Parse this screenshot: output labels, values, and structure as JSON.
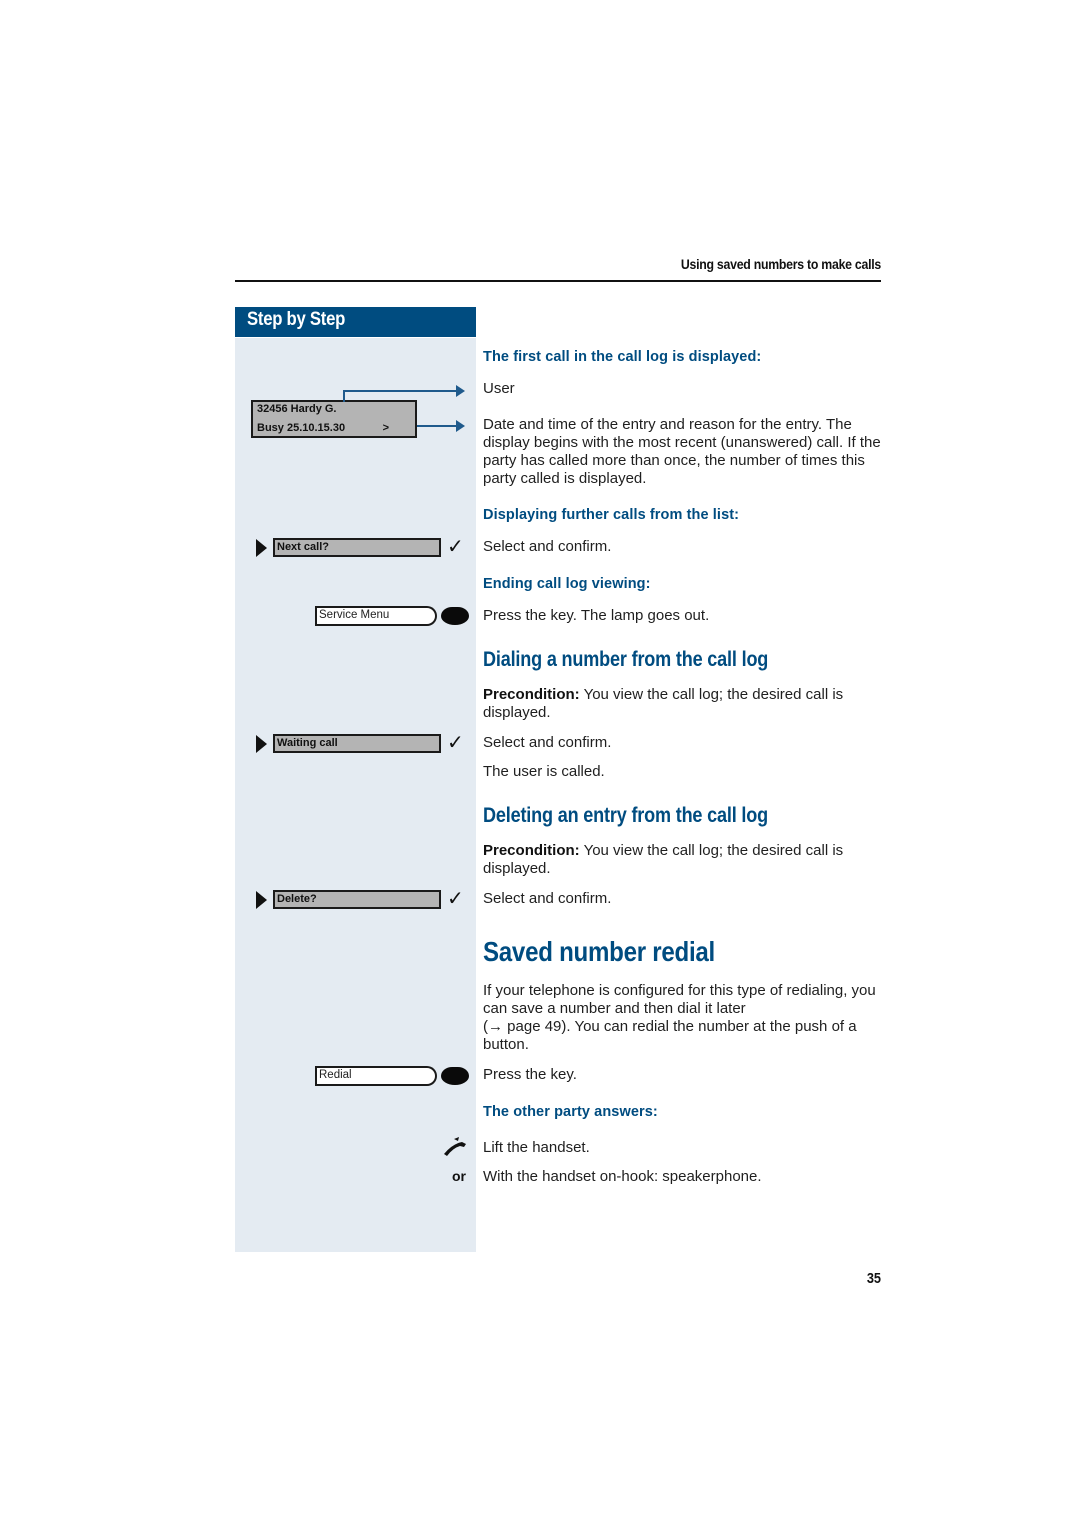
{
  "header": {
    "running_title": "Using saved numbers to make calls"
  },
  "sidebar": {
    "title": "Step by Step",
    "display": {
      "line1": "32456 Hardy G.",
      "line2": "Busy 25.10.15.30",
      "line2_arrow": ">"
    },
    "options": [
      {
        "label": "Next call?",
        "confirm_icon": "check-icon"
      },
      {
        "label": "Waiting call",
        "confirm_icon": "check-icon"
      },
      {
        "label": "Delete?",
        "confirm_icon": "check-icon"
      }
    ],
    "keys": [
      {
        "label": "Service Menu",
        "icon": "key-lamp-icon"
      },
      {
        "label": "Redial",
        "icon": "key-lamp-icon"
      }
    ],
    "handset_icon": "handset-lift-icon",
    "or_label": "or"
  },
  "content": {
    "first_call": {
      "subheading": "The first call in the call log is displayed:",
      "user": "User",
      "date_desc": "Date and time of the entry and reason for the entry. The display begins with the most recent (unanswered) call. If the party has called more than once, the number of times this party called is displayed."
    },
    "further_calls": {
      "subheading": "Displaying further calls from the list:",
      "text": "Select and confirm."
    },
    "ending": {
      "subheading": "Ending call log viewing:",
      "text": "Press the key. The lamp goes out."
    },
    "dialing": {
      "heading": "Dialing a number from the call log",
      "precondition_label": "Precondition:",
      "precondition_text": " You view the call log; the desired call is displayed.",
      "select_text": "Select and confirm.",
      "result_text": "The user is called."
    },
    "deleting": {
      "heading": "Deleting an entry from the call log",
      "precondition_label": "Precondition:",
      "precondition_text": " You view the call log; the desired call is displayed.",
      "select_text": "Select and confirm."
    },
    "saved_redial": {
      "heading": "Saved number redial",
      "intro_part1": "If your telephone is configured for this type of redialing, you can save a number and then dial it later",
      "intro_arrow": "→",
      "intro_part2": " page 49). You can redial the number at the push of a button.",
      "press_text": "Press the key.",
      "answers_subheading": "The other party answers:",
      "lift_text": "Lift the handset.",
      "speaker_text": "With the handset on-hook: speakerphone."
    }
  },
  "footer": {
    "page_number": "35"
  },
  "colors": {
    "brand_blue": "#004c80",
    "sidebar_bg": "#e4ebf2",
    "display_gray": "#b4b4b4"
  }
}
